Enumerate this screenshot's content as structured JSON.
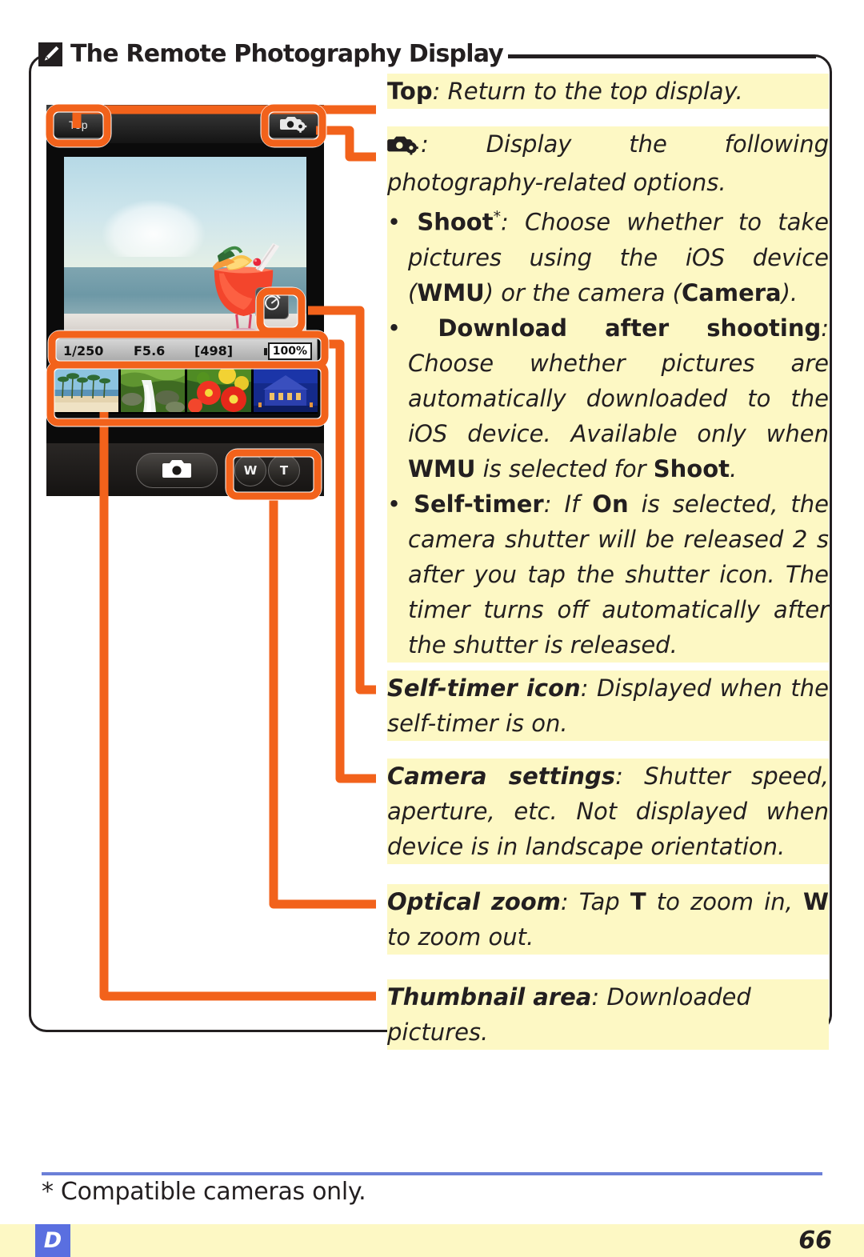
{
  "note": {
    "icon": "pencil-icon",
    "title": "The Remote Photography Display"
  },
  "device": {
    "top_button_label": "Top",
    "camera_settings_icon": "camera-gear-icon",
    "self_timer_icon": "self-timer-icon",
    "status": {
      "shutter_speed": "1/250",
      "aperture": "F5.6",
      "frames_remaining": "[498]",
      "battery_level": "100%"
    },
    "thumbnails": [
      {
        "name": "beach-palm-trees"
      },
      {
        "name": "forest-waterfall"
      },
      {
        "name": "red-poppies"
      },
      {
        "name": "night-building"
      }
    ],
    "shutter_button_icon": "camera-shutter-icon",
    "zoom_wide_label": "W",
    "zoom_tele_label": "T"
  },
  "callouts": {
    "top": {
      "term": "Top",
      "sep": ": ",
      "body": "Return to the top display."
    },
    "camera_icon": {
      "sep": ": ",
      "body": "Display the following photography-related options.",
      "bullets": [
        {
          "term": "Shoot",
          "star": "*",
          "sep": ": ",
          "body_1": "Choose whether to take pictures using the iOS device (",
          "bold_1": "WMU",
          "body_2": ") or the camera (",
          "bold_2": "Camera",
          "body_3": ")."
        },
        {
          "term": "Download after shooting",
          "sep": ": ",
          "body_1": "Choose whether pictures are automatically downloaded to the iOS device. Available only when ",
          "bold_1": "WMU",
          "body_2": " is selected for ",
          "bold_2": "Shoot",
          "body_3": "."
        },
        {
          "term": "Self-timer",
          "sep": ": ",
          "body_1": "If ",
          "bold_1": "On",
          "body_2": " is selected, the camera shutter will be released 2 s after you tap the shutter icon. The timer turns off automatically after the shutter is released."
        }
      ]
    },
    "self_timer_icon": {
      "term": "Self-timer icon",
      "sep": ": ",
      "body": "Displayed when the self-timer is on."
    },
    "camera_settings": {
      "term": "Camera settings",
      "sep": ": ",
      "body": "Shutter speed, aperture, etc. Not displayed when device is in landscape orientation."
    },
    "optical_zoom": {
      "term": "Optical zoom",
      "sep": ": ",
      "body_1": "Tap ",
      "bold_1": "T",
      "body_2": " to zoom in, ",
      "bold_2": "W",
      "body_3": " to zoom out."
    },
    "thumbnail_area": {
      "term": "Thumbnail area",
      "sep": ": ",
      "body": "Downloaded pictures."
    }
  },
  "footnote": "* Compatible cameras only.",
  "footer": {
    "tab_label": "D",
    "page_number": "66"
  },
  "colors": {
    "callout_orange": "#F2621B",
    "highlight_yellow": "#FDF8C4",
    "footer_tab_blue": "#5A6FE0",
    "footnote_rule_blue": "#6B7FD7",
    "ink": "#231F20"
  }
}
